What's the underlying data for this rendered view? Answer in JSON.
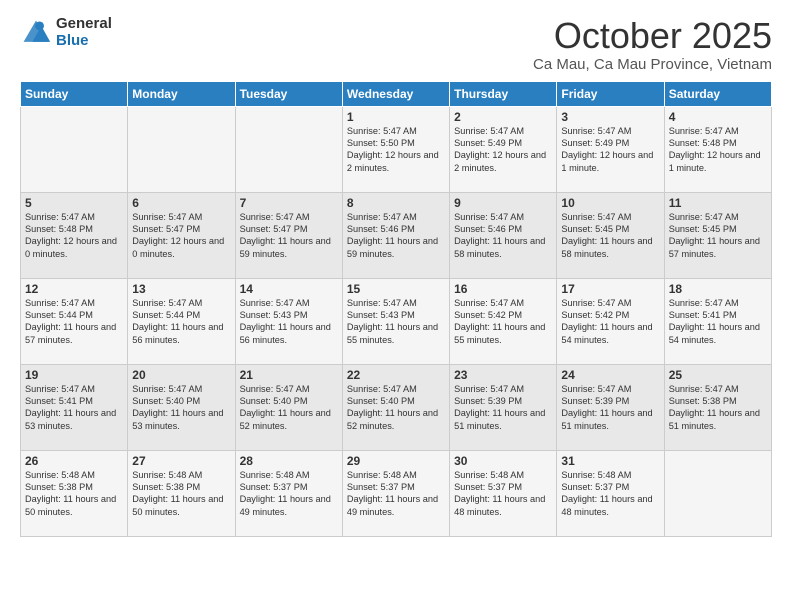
{
  "logo": {
    "general": "General",
    "blue": "Blue"
  },
  "header": {
    "title": "October 2025",
    "subtitle": "Ca Mau, Ca Mau Province, Vietnam"
  },
  "days_of_week": [
    "Sunday",
    "Monday",
    "Tuesday",
    "Wednesday",
    "Thursday",
    "Friday",
    "Saturday"
  ],
  "weeks": [
    [
      {
        "day": "",
        "sunrise": "",
        "sunset": "",
        "daylight": ""
      },
      {
        "day": "",
        "sunrise": "",
        "sunset": "",
        "daylight": ""
      },
      {
        "day": "",
        "sunrise": "",
        "sunset": "",
        "daylight": ""
      },
      {
        "day": "1",
        "sunrise": "Sunrise: 5:47 AM",
        "sunset": "Sunset: 5:50 PM",
        "daylight": "Daylight: 12 hours and 2 minutes."
      },
      {
        "day": "2",
        "sunrise": "Sunrise: 5:47 AM",
        "sunset": "Sunset: 5:49 PM",
        "daylight": "Daylight: 12 hours and 2 minutes."
      },
      {
        "day": "3",
        "sunrise": "Sunrise: 5:47 AM",
        "sunset": "Sunset: 5:49 PM",
        "daylight": "Daylight: 12 hours and 1 minute."
      },
      {
        "day": "4",
        "sunrise": "Sunrise: 5:47 AM",
        "sunset": "Sunset: 5:48 PM",
        "daylight": "Daylight: 12 hours and 1 minute."
      }
    ],
    [
      {
        "day": "5",
        "sunrise": "Sunrise: 5:47 AM",
        "sunset": "Sunset: 5:48 PM",
        "daylight": "Daylight: 12 hours and 0 minutes."
      },
      {
        "day": "6",
        "sunrise": "Sunrise: 5:47 AM",
        "sunset": "Sunset: 5:47 PM",
        "daylight": "Daylight: 12 hours and 0 minutes."
      },
      {
        "day": "7",
        "sunrise": "Sunrise: 5:47 AM",
        "sunset": "Sunset: 5:47 PM",
        "daylight": "Daylight: 11 hours and 59 minutes."
      },
      {
        "day": "8",
        "sunrise": "Sunrise: 5:47 AM",
        "sunset": "Sunset: 5:46 PM",
        "daylight": "Daylight: 11 hours and 59 minutes."
      },
      {
        "day": "9",
        "sunrise": "Sunrise: 5:47 AM",
        "sunset": "Sunset: 5:46 PM",
        "daylight": "Daylight: 11 hours and 58 minutes."
      },
      {
        "day": "10",
        "sunrise": "Sunrise: 5:47 AM",
        "sunset": "Sunset: 5:45 PM",
        "daylight": "Daylight: 11 hours and 58 minutes."
      },
      {
        "day": "11",
        "sunrise": "Sunrise: 5:47 AM",
        "sunset": "Sunset: 5:45 PM",
        "daylight": "Daylight: 11 hours and 57 minutes."
      }
    ],
    [
      {
        "day": "12",
        "sunrise": "Sunrise: 5:47 AM",
        "sunset": "Sunset: 5:44 PM",
        "daylight": "Daylight: 11 hours and 57 minutes."
      },
      {
        "day": "13",
        "sunrise": "Sunrise: 5:47 AM",
        "sunset": "Sunset: 5:44 PM",
        "daylight": "Daylight: 11 hours and 56 minutes."
      },
      {
        "day": "14",
        "sunrise": "Sunrise: 5:47 AM",
        "sunset": "Sunset: 5:43 PM",
        "daylight": "Daylight: 11 hours and 56 minutes."
      },
      {
        "day": "15",
        "sunrise": "Sunrise: 5:47 AM",
        "sunset": "Sunset: 5:43 PM",
        "daylight": "Daylight: 11 hours and 55 minutes."
      },
      {
        "day": "16",
        "sunrise": "Sunrise: 5:47 AM",
        "sunset": "Sunset: 5:42 PM",
        "daylight": "Daylight: 11 hours and 55 minutes."
      },
      {
        "day": "17",
        "sunrise": "Sunrise: 5:47 AM",
        "sunset": "Sunset: 5:42 PM",
        "daylight": "Daylight: 11 hours and 54 minutes."
      },
      {
        "day": "18",
        "sunrise": "Sunrise: 5:47 AM",
        "sunset": "Sunset: 5:41 PM",
        "daylight": "Daylight: 11 hours and 54 minutes."
      }
    ],
    [
      {
        "day": "19",
        "sunrise": "Sunrise: 5:47 AM",
        "sunset": "Sunset: 5:41 PM",
        "daylight": "Daylight: 11 hours and 53 minutes."
      },
      {
        "day": "20",
        "sunrise": "Sunrise: 5:47 AM",
        "sunset": "Sunset: 5:40 PM",
        "daylight": "Daylight: 11 hours and 53 minutes."
      },
      {
        "day": "21",
        "sunrise": "Sunrise: 5:47 AM",
        "sunset": "Sunset: 5:40 PM",
        "daylight": "Daylight: 11 hours and 52 minutes."
      },
      {
        "day": "22",
        "sunrise": "Sunrise: 5:47 AM",
        "sunset": "Sunset: 5:40 PM",
        "daylight": "Daylight: 11 hours and 52 minutes."
      },
      {
        "day": "23",
        "sunrise": "Sunrise: 5:47 AM",
        "sunset": "Sunset: 5:39 PM",
        "daylight": "Daylight: 11 hours and 51 minutes."
      },
      {
        "day": "24",
        "sunrise": "Sunrise: 5:47 AM",
        "sunset": "Sunset: 5:39 PM",
        "daylight": "Daylight: 11 hours and 51 minutes."
      },
      {
        "day": "25",
        "sunrise": "Sunrise: 5:47 AM",
        "sunset": "Sunset: 5:38 PM",
        "daylight": "Daylight: 11 hours and 51 minutes."
      }
    ],
    [
      {
        "day": "26",
        "sunrise": "Sunrise: 5:48 AM",
        "sunset": "Sunset: 5:38 PM",
        "daylight": "Daylight: 11 hours and 50 minutes."
      },
      {
        "day": "27",
        "sunrise": "Sunrise: 5:48 AM",
        "sunset": "Sunset: 5:38 PM",
        "daylight": "Daylight: 11 hours and 50 minutes."
      },
      {
        "day": "28",
        "sunrise": "Sunrise: 5:48 AM",
        "sunset": "Sunset: 5:37 PM",
        "daylight": "Daylight: 11 hours and 49 minutes."
      },
      {
        "day": "29",
        "sunrise": "Sunrise: 5:48 AM",
        "sunset": "Sunset: 5:37 PM",
        "daylight": "Daylight: 11 hours and 49 minutes."
      },
      {
        "day": "30",
        "sunrise": "Sunrise: 5:48 AM",
        "sunset": "Sunset: 5:37 PM",
        "daylight": "Daylight: 11 hours and 48 minutes."
      },
      {
        "day": "31",
        "sunrise": "Sunrise: 5:48 AM",
        "sunset": "Sunset: 5:37 PM",
        "daylight": "Daylight: 11 hours and 48 minutes."
      },
      {
        "day": "",
        "sunrise": "",
        "sunset": "",
        "daylight": ""
      }
    ]
  ]
}
